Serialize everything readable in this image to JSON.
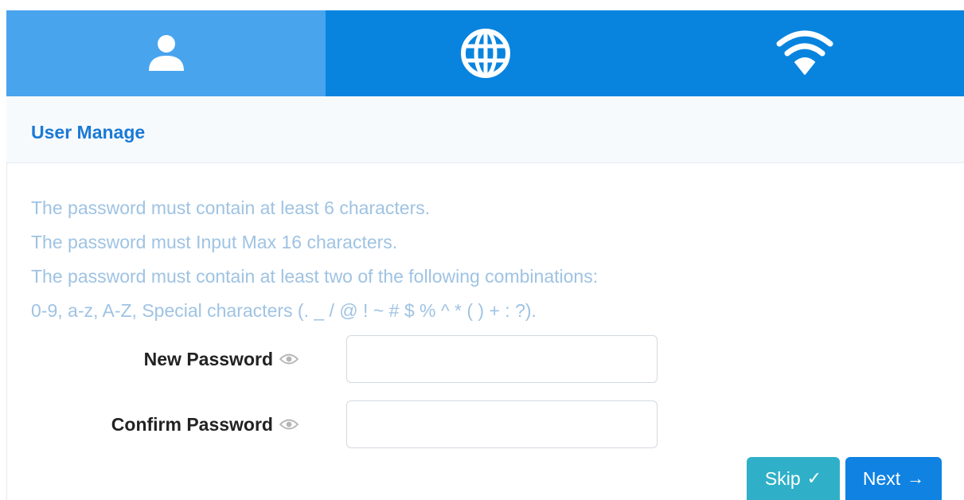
{
  "tabs": [
    {
      "name": "user",
      "icon": "user-icon",
      "active": true
    },
    {
      "name": "internet",
      "icon": "globe-icon",
      "active": false
    },
    {
      "name": "wifi",
      "icon": "wifi-icon",
      "active": false
    }
  ],
  "section": {
    "title": "User Manage"
  },
  "rules": [
    "The password must contain at least 6 characters.",
    "The password must Input Max 16 characters.",
    "The password must contain at least two of the following combinations:",
    "0-9, a-z, A-Z, Special characters (. _ / @ ! ~ # $ % ^ * ( ) + : ?)."
  ],
  "form": {
    "new_password": {
      "label": "New Password",
      "value": "",
      "placeholder": ""
    },
    "confirm_password": {
      "label": "Confirm Password",
      "value": "",
      "placeholder": ""
    }
  },
  "buttons": {
    "skip_label": "Skip",
    "skip_icon": "✓",
    "next_label": "Next",
    "next_icon": "→"
  },
  "colors": {
    "tab_bar": "#0884df",
    "tab_active": "#49a4ee",
    "title": "#1a79d6",
    "hint_text": "#9fc3e3",
    "skip": "#2fb0c8",
    "next": "#0f82e2"
  }
}
